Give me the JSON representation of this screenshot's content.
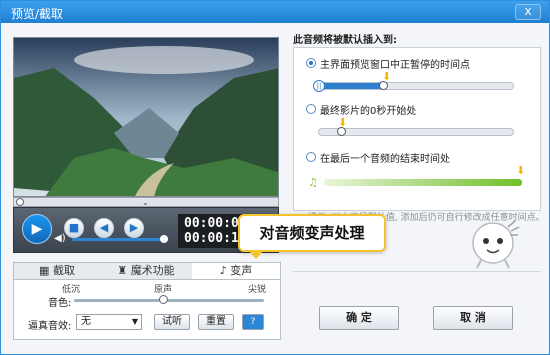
{
  "window": {
    "title": "预览/截取",
    "close_icon": "x"
  },
  "player": {
    "time_current": "00:00:00",
    "time_total": "00:00:12",
    "seek_fraction": 0.02,
    "volume_fraction": 1.0
  },
  "tabs": [
    {
      "label": "截取",
      "icon": "film-icon"
    },
    {
      "label": "魔术功能",
      "icon": "magic-hat-icon"
    },
    {
      "label": "变声",
      "icon": "note-icon",
      "active": true
    }
  ],
  "voice": {
    "labels": [
      "低沉",
      "原声",
      "尖锐"
    ],
    "tone_label": "音色:",
    "effect_label": "逼真音效:",
    "effect_value": "无",
    "listen_btn": "试听",
    "reset_btn": "重置",
    "help_btn": "?"
  },
  "insert": {
    "heading": "此音频将被默认插入到:",
    "options": [
      {
        "label": "主界面预览窗口中正暂停的时间点",
        "selected": true
      },
      {
        "label": "最终影片的0秒开始处",
        "selected": false
      },
      {
        "label": "在最后一个音频的结束时间处",
        "selected": false
      }
    ],
    "hint": "提示: 以上只是默认值, 添加后仍可自行修改成任意时间点。"
  },
  "callout": "对音频变声处理",
  "buttons": {
    "ok": "确 定",
    "cancel": "取 消"
  }
}
